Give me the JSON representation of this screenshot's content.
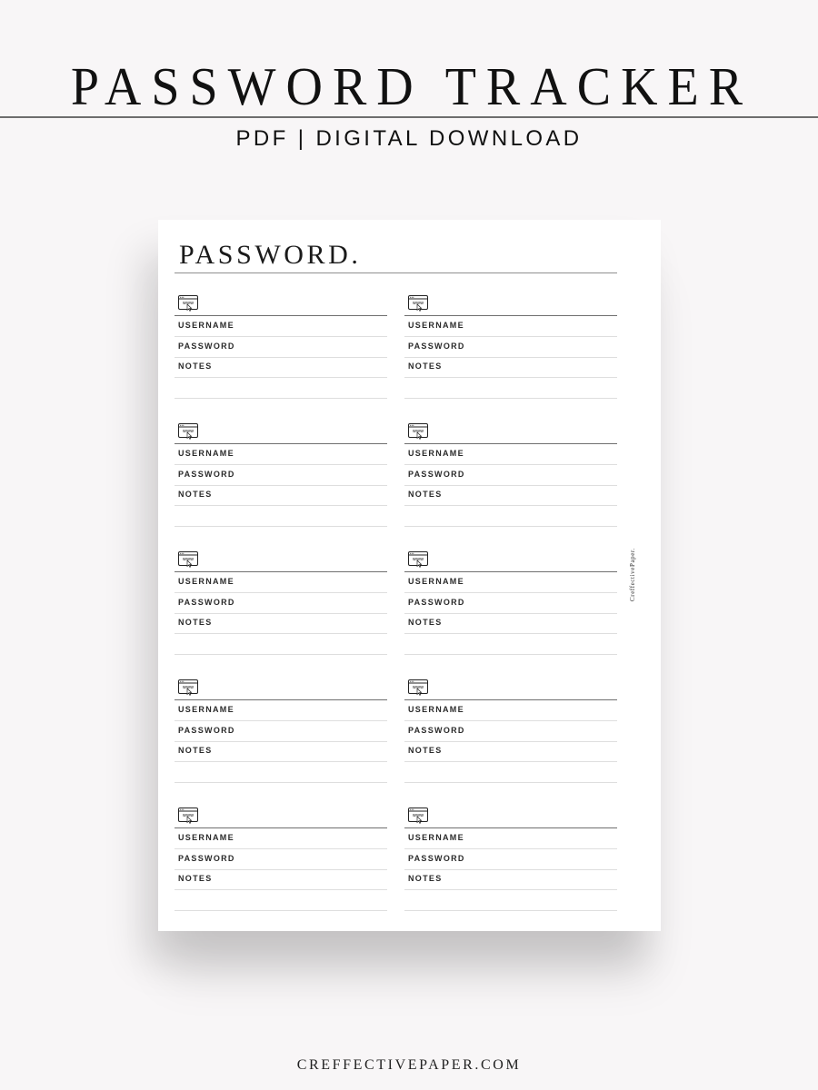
{
  "header": {
    "title": "PASSWORD TRACKER",
    "subtitle": "PDF | DIGITAL DOWNLOAD"
  },
  "page": {
    "heading": "PASSWORD.",
    "brand": "CreffectivePaper.",
    "entry_icon": "www-browser-icon",
    "entries": [
      {
        "fields": [
          "USERNAME",
          "PASSWORD",
          "NOTES",
          ""
        ]
      },
      {
        "fields": [
          "USERNAME",
          "PASSWORD",
          "NOTES",
          ""
        ]
      },
      {
        "fields": [
          "USERNAME",
          "PASSWORD",
          "NOTES",
          ""
        ]
      },
      {
        "fields": [
          "USERNAME",
          "PASSWORD",
          "NOTES",
          ""
        ]
      },
      {
        "fields": [
          "USERNAME",
          "PASSWORD",
          "NOTES",
          ""
        ]
      },
      {
        "fields": [
          "USERNAME",
          "PASSWORD",
          "NOTES",
          ""
        ]
      },
      {
        "fields": [
          "USERNAME",
          "PASSWORD",
          "NOTES",
          ""
        ]
      },
      {
        "fields": [
          "USERNAME",
          "PASSWORD",
          "NOTES",
          ""
        ]
      },
      {
        "fields": [
          "USERNAME",
          "PASSWORD",
          "NOTES",
          ""
        ]
      },
      {
        "fields": [
          "USERNAME",
          "PASSWORD",
          "NOTES",
          ""
        ]
      }
    ]
  },
  "footer": {
    "website": "CREFFECTIVEPAPER.COM"
  },
  "colors": {
    "background": "#f8f6f7",
    "paper": "#ffffff",
    "text": "#1a1a1a",
    "rule_dark": "#6f6f6f",
    "rule_light": "#dedede"
  }
}
